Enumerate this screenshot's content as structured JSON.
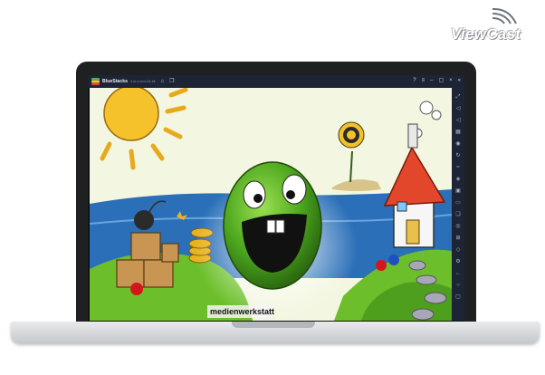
{
  "watermark": {
    "text": "ViewCast"
  },
  "emulator": {
    "title": "BlueStacks",
    "version": "4.xx.x.xxxx  64-bit",
    "left_icons": [
      "home-icon",
      "multi-instance-icon"
    ],
    "window_controls": [
      "help-icon",
      "menu-icon",
      "minimize-icon",
      "restore-icon",
      "close-icon",
      "collapse-icon"
    ],
    "sidebar_icons": [
      "fullscreen-icon",
      "volume-up-icon",
      "volume-down-icon",
      "keyboard-icon",
      "screen-record-icon",
      "rotate-icon",
      "shake-icon",
      "gamepad-icon",
      "screenshot-icon",
      "folder-icon",
      "copy-icon",
      "location-icon",
      "macro-icon",
      "eco-mode-icon",
      "settings-icon",
      "back-icon",
      "home-icon",
      "recent-apps-icon"
    ]
  },
  "game": {
    "publisher_logo": "medienwerkstatt"
  }
}
